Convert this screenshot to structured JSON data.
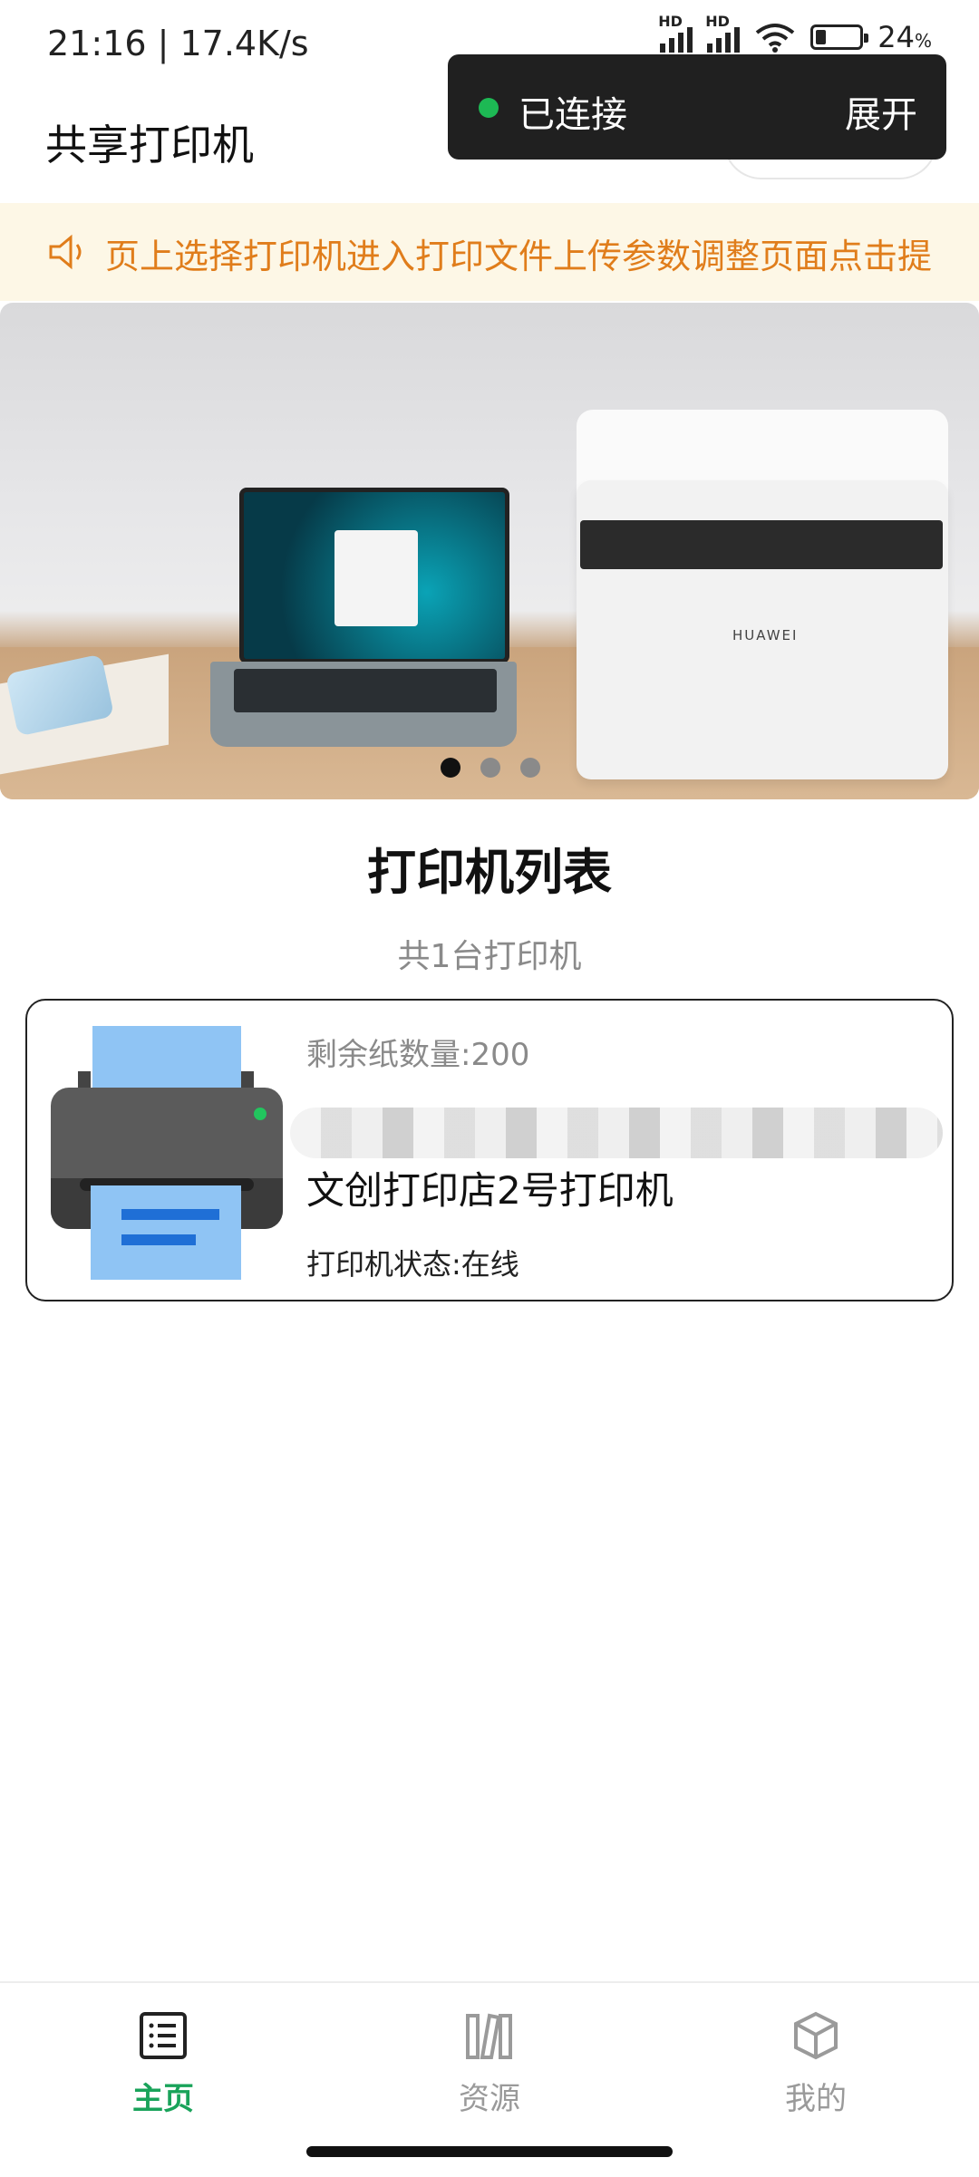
{
  "status_bar": {
    "time_speed": "21:16 | 17.4K/s",
    "signal_1_label": "HD",
    "signal_2_label": "HD",
    "battery_percent": "24",
    "battery_percent_sign": "%",
    "battery_level": 0.24
  },
  "header": {
    "title": "共享打印机"
  },
  "toast": {
    "status": "已连接",
    "expand_label": "展开",
    "status_color": "#1db954"
  },
  "notice": {
    "text": "页上选择打印机进入打印文件上传参数调整页面点击提"
  },
  "banner": {
    "printer_brand": "HUAWEI",
    "active_slide": 1,
    "slide_count": 3
  },
  "printer_list": {
    "title": "打印机列表",
    "count_text": "共1台打印机",
    "printers": [
      {
        "paper_count": "剩余纸数量:200",
        "name": "文创打印店2号打印机",
        "status": "打印机状态:在线"
      }
    ]
  },
  "tabbar": {
    "tabs": [
      {
        "label": "主页",
        "icon": "list-icon",
        "active": true
      },
      {
        "label": "资源",
        "icon": "books-icon",
        "active": false
      },
      {
        "label": "我的",
        "icon": "cube-icon",
        "active": false
      }
    ],
    "active_color": "#19a35a",
    "inactive_color": "#9a9a9a"
  }
}
